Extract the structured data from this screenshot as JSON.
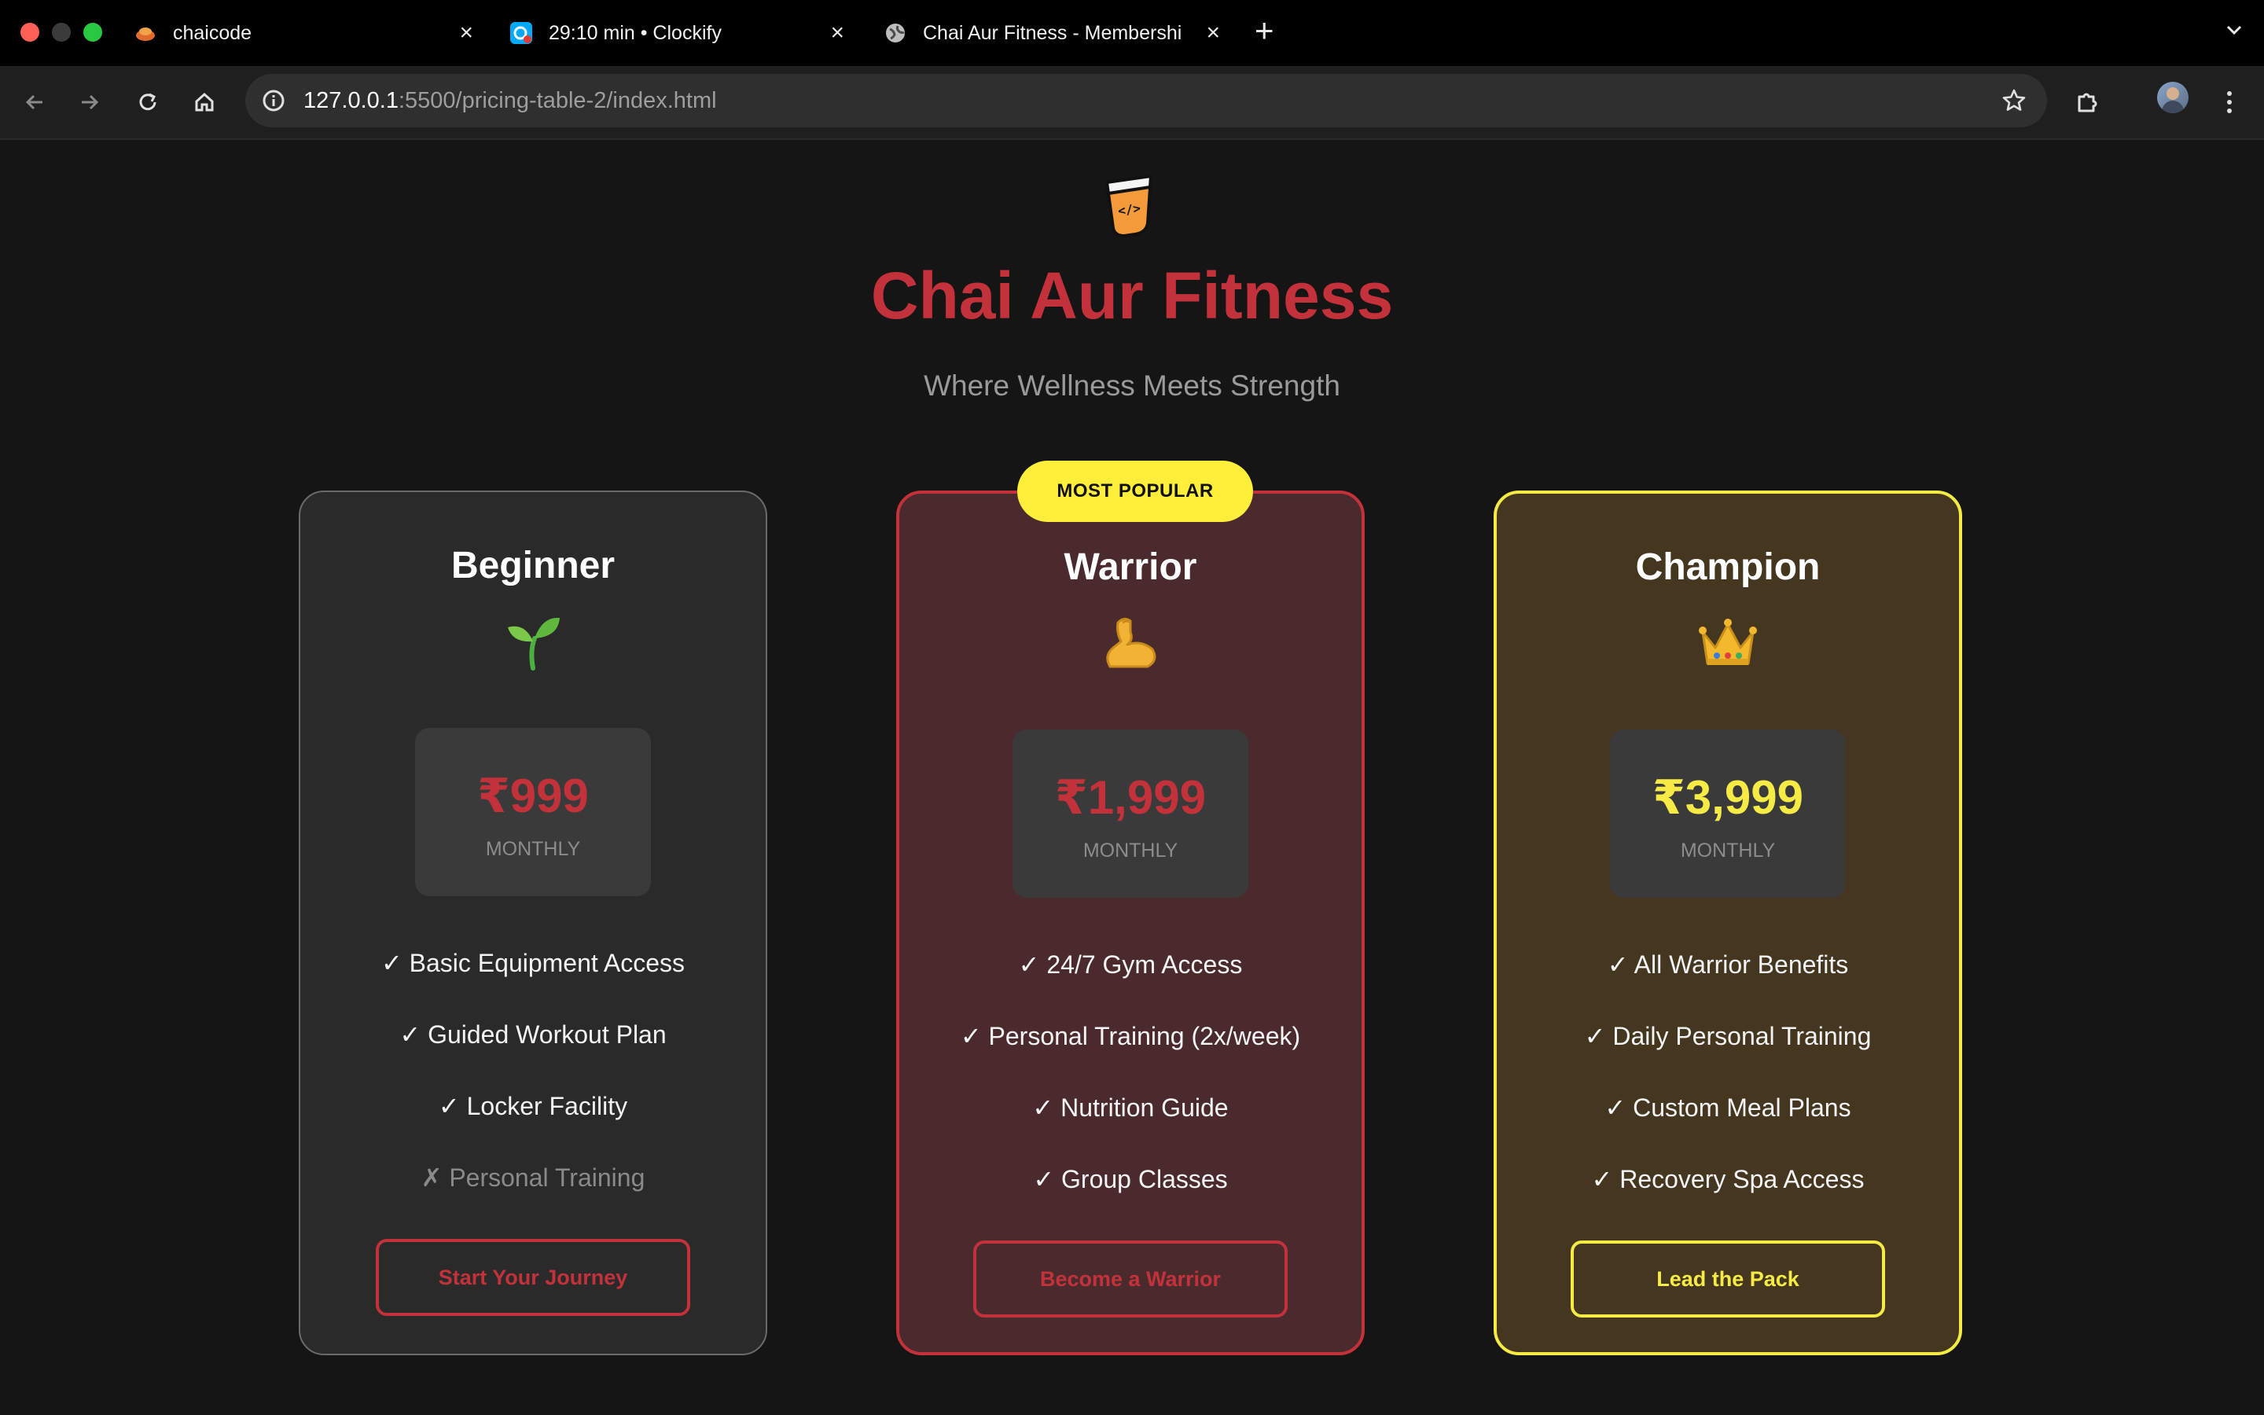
{
  "browser": {
    "tabs": [
      {
        "title": "chaicode",
        "icon": "chaicode-favicon-icon",
        "active": false
      },
      {
        "title": "29:10 min • Clockify",
        "icon": "clockify-favicon-icon",
        "active": false
      },
      {
        "title": "Chai Aur Fitness - Membershi",
        "icon": "globe-icon",
        "active": true
      }
    ],
    "new_tab_label": "+",
    "url_host": "127.0.0.1",
    "url_rest": ":5500/pricing-table-2/index.html"
  },
  "page": {
    "title": "Chai Aur Fitness",
    "tagline": "Where Wellness Meets Strength",
    "popular_badge": "MOST POPULAR",
    "plans": [
      {
        "name": "Beginner",
        "emoji": "seedling-icon",
        "price": "₹999",
        "period": "MONTHLY",
        "price_color": "#c3323b",
        "features": [
          {
            "text": "✓ Basic Equipment Access",
            "included": true
          },
          {
            "text": "✓ Guided Workout Plan",
            "included": true
          },
          {
            "text": "✓ Locker Facility",
            "included": true
          },
          {
            "text": "✗ Personal Training",
            "included": false
          }
        ],
        "cta": "Start Your Journey"
      },
      {
        "name": "Warrior",
        "emoji": "flexed-biceps-icon",
        "price": "₹1,999",
        "period": "MONTHLY",
        "price_color": "#c3323b",
        "features": [
          {
            "text": "✓ 24/7 Gym Access",
            "included": true
          },
          {
            "text": "✓ Personal Training (2x/week)",
            "included": true
          },
          {
            "text": "✓ Nutrition Guide",
            "included": true
          },
          {
            "text": "✓ Group Classes",
            "included": true
          }
        ],
        "cta": "Become a Warrior"
      },
      {
        "name": "Champion",
        "emoji": "crown-icon",
        "price": "₹3,999",
        "period": "MONTHLY",
        "price_color": "#f6ea45",
        "features": [
          {
            "text": "✓ All Warrior Benefits",
            "included": true
          },
          {
            "text": "✓ Daily Personal Training",
            "included": true
          },
          {
            "text": "✓ Custom Meal Plans",
            "included": true
          },
          {
            "text": "✓ Recovery Spa Access",
            "included": true
          }
        ],
        "cta": "Lead the Pack"
      }
    ]
  },
  "colors": {
    "accent_red": "#c3323b",
    "accent_yellow": "#f6ea45",
    "badge_yellow": "#ffee3a",
    "page_bg": "#151515"
  }
}
